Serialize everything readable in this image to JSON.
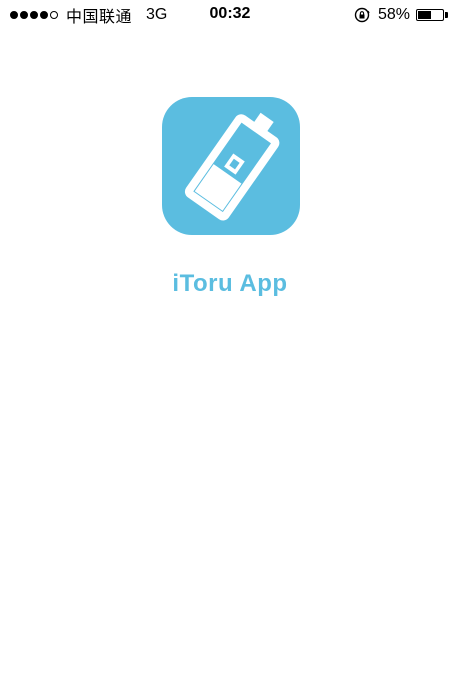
{
  "status_bar": {
    "signal_bars_filled": 4,
    "signal_bars_total": 5,
    "carrier": "中国联通",
    "network": "3G",
    "time": "00:32",
    "battery_percent_label": "58%",
    "battery_level": 0.58
  },
  "app": {
    "name": "iToru App",
    "accent_color": "#5bbde0",
    "icon": "e-cigarette-battery-icon"
  }
}
